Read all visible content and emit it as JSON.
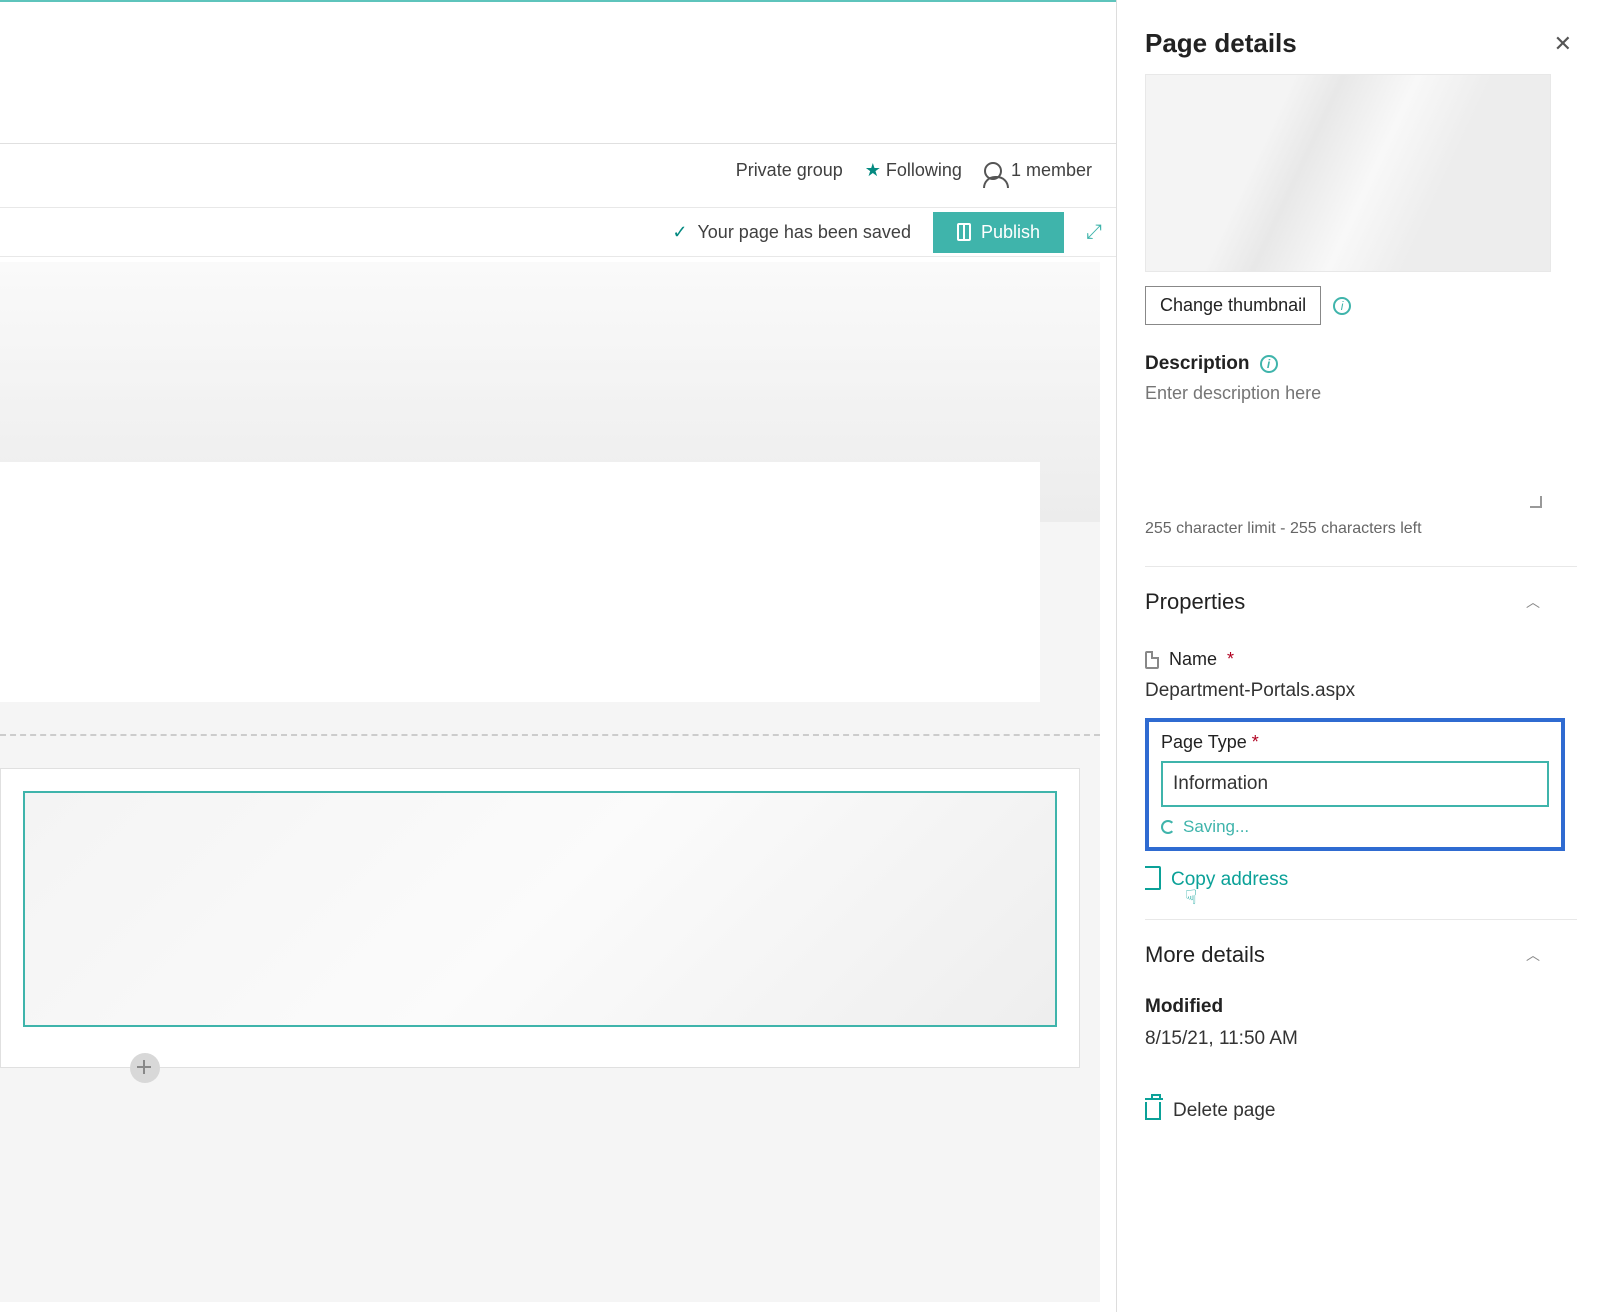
{
  "site": {
    "group_label": "Private group",
    "following_label": "Following",
    "member_count": "1 member"
  },
  "toolbar": {
    "saved_message": "Your page has been saved",
    "publish_label": "Publish"
  },
  "panel": {
    "title": "Page details",
    "change_thumbnail_label": "Change thumbnail",
    "description_label": "Description",
    "description_placeholder": "Enter description here",
    "char_limit_text": "255 character limit - 255 characters left",
    "properties": {
      "section_label": "Properties",
      "name_label": "Name",
      "name_value": "Department-Portals.aspx",
      "page_type_label": "Page Type",
      "page_type_value": "Information",
      "saving_label": "Saving...",
      "copy_address_label": "Copy address"
    },
    "more": {
      "section_label": "More details",
      "modified_label": "Modified",
      "modified_value": "8/15/21, 11:50 AM"
    },
    "delete_label": "Delete page"
  }
}
